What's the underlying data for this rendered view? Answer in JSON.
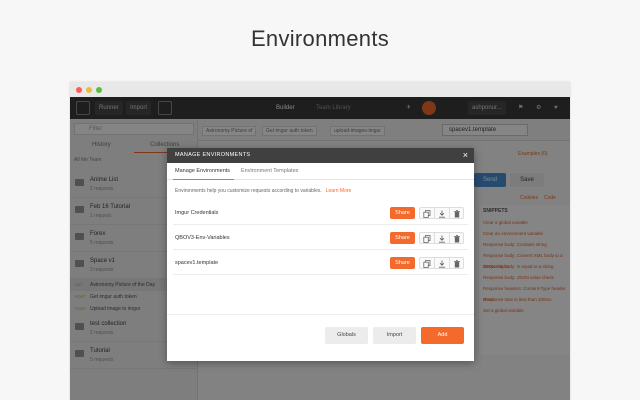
{
  "headline": "Environments",
  "toolbar": {
    "runner_label": "Runner",
    "import_label": "Import",
    "builder_label": "Builder",
    "team_library_label": "Team Library",
    "user_label": "ashponur..."
  },
  "sidebar": {
    "filter_placeholder": "Filter",
    "tabs": [
      "History",
      "Collections"
    ],
    "sub": "All   Me   Team",
    "items": [
      {
        "name": "Anime List",
        "count": "2 requests"
      },
      {
        "name": "Feb 16 Tutorial",
        "count": "1 request"
      },
      {
        "name": "Forex",
        "count": "5 requests"
      },
      {
        "name": "Space v1",
        "count": "3 requests"
      }
    ],
    "requests": [
      {
        "method": "GET",
        "name": "Astronomy Picture of the Day"
      },
      {
        "method": "POST",
        "name": "Get imgur auth token"
      },
      {
        "method": "POST",
        "name": "Upload image to imgur"
      }
    ],
    "items2": [
      {
        "name": "test collection",
        "count": "2 requests"
      },
      {
        "name": "Tutorial",
        "count": "5 requests"
      }
    ]
  },
  "main": {
    "tabs": [
      "Astronomy Picture of",
      "Get imgur auth token",
      "upload-images-imgur"
    ],
    "env_selected": "spacev1.template",
    "examples_label": "Examples (0)",
    "send_label": "Send",
    "save_label": "Save",
    "cookies_label": "Cookies",
    "code_label": "Code",
    "snippets_header": "SNIPPETS",
    "snippets": [
      "Clear a global variable",
      "Clear an environment variable",
      "Response body: Contains string",
      "Response body: Convert XML body to a JSON Object",
      "Response body: Is equal to a string",
      "Response body: JSON value check",
      "Response headers: Content-Type header check",
      "Response time is less than 200ms",
      "Set a global variable"
    ]
  },
  "modal": {
    "title": "MANAGE ENVIRONMENTS",
    "tabs": [
      "Manage Environments",
      "Environment Templates"
    ],
    "description": "Environments help you customize requests according to variables.",
    "learn_more": "Learn More",
    "environments": [
      {
        "name": "Imgur Credentials"
      },
      {
        "name": "QBOV3-Env-Variables"
      },
      {
        "name": "spacev1.template"
      }
    ],
    "share_label": "Share",
    "globals_label": "Globals",
    "import_label": "Import",
    "add_label": "Add"
  },
  "colors": {
    "accent": "#f36a2c",
    "header": "#404040"
  }
}
